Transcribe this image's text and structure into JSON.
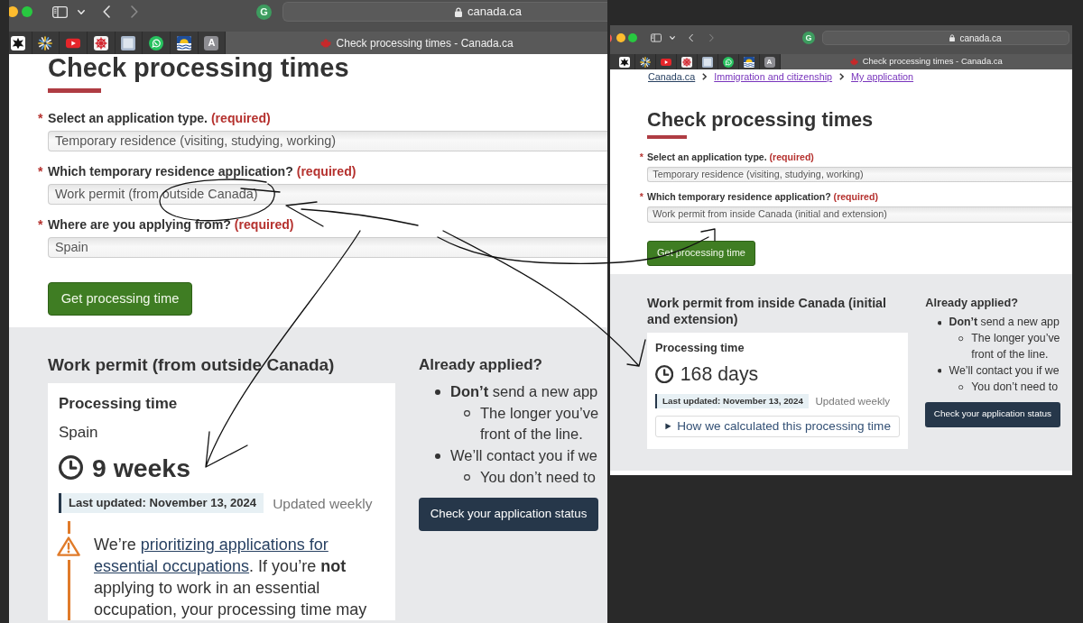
{
  "windows": [
    {
      "toolbar": {
        "extension_badge": "G",
        "address": "canada.ca"
      },
      "bookmarks": [
        {
          "kind": "splat"
        },
        {
          "kind": "sunburst"
        },
        {
          "kind": "video"
        },
        {
          "kind": "snowflake"
        },
        {
          "kind": "square"
        },
        {
          "kind": "chat"
        },
        {
          "kind": "flag"
        },
        {
          "kind": "letter",
          "label": "A"
        }
      ],
      "tab": {
        "title": "Check processing times - Canada.ca"
      },
      "page": {
        "heading": "Check processing times",
        "fields": [
          {
            "mark": "*",
            "label": "Select an application type.",
            "required": "(required)",
            "value": "Temporary residence (visiting, studying, working)"
          },
          {
            "mark": "*",
            "label": "Which temporary residence application?",
            "required": "(required)",
            "value": "Work permit (from outside Canada)"
          },
          {
            "mark": "*",
            "label": "Where are you applying from?",
            "required": "(required)",
            "value": "Spain"
          }
        ],
        "submit": "Get processing time",
        "result": {
          "heading": "Work permit (from outside Canada)",
          "card_title": "Processing time",
          "location": "Spain",
          "duration": "9 weeks",
          "last_updated": "Last updated: November 13, 2024",
          "frequency": "Updated weekly",
          "notice": {
            "before": "We’re ",
            "link": [
              "prioritizing applications for",
              "essential occupations"
            ],
            "after": ". If you’re **not** applying to work in an essential occupation, your processing time may"
          }
        },
        "aside": {
          "heading": "Already applied?",
          "items": [
            {
              "lines": [
                "**Don’t** send a new app"
              ],
              "children": [
                {
                  "lines": [
                    "The longer you’ve",
                    "front of the line."
                  ]
                }
              ]
            },
            {
              "lines": [
                "We’ll contact you if we"
              ],
              "children": [
                {
                  "lines": [
                    "You don’t need to"
                  ]
                }
              ]
            }
          ],
          "button": "Check your application status"
        }
      }
    },
    {
      "toolbar": {
        "extension_badge": "G",
        "address": "canada.ca"
      },
      "bookmarks": [
        {
          "kind": "splat"
        },
        {
          "kind": "sunburst"
        },
        {
          "kind": "video"
        },
        {
          "kind": "snowflake"
        },
        {
          "kind": "square"
        },
        {
          "kind": "chat"
        },
        {
          "kind": "flag"
        },
        {
          "kind": "letter",
          "label": "A"
        }
      ],
      "tab": {
        "title": "Check processing times - Canada.ca"
      },
      "page": {
        "breadcrumb": [
          {
            "text": "Canada.ca",
            "visited": false
          },
          {
            "text": "Immigration and citizenship",
            "visited": true
          },
          {
            "text": "My application",
            "visited": true
          }
        ],
        "heading": "Check processing times",
        "fields": [
          {
            "mark": "*",
            "label": "Select an application type.",
            "required": "(required)",
            "value": "Temporary residence (visiting, studying, working)"
          },
          {
            "mark": "*",
            "label": "Which temporary residence application?",
            "required": "(required)",
            "value": "Work permit from inside Canada (initial and extension)"
          }
        ],
        "submit": "Get processing time",
        "result": {
          "heading": "Work permit from inside Canada (initial and extension)",
          "card_title": "Processing time",
          "duration": "168 days",
          "last_updated": "Last updated: November 13, 2024",
          "frequency": "Updated weekly",
          "details": {
            "label": "How we calculated this processing time",
            "expanded": false
          }
        },
        "aside": {
          "heading": "Already applied?",
          "items": [
            {
              "lines": [
                "**Don’t** send a new app"
              ],
              "children": [
                {
                  "lines": [
                    "The longer you’ve",
                    "front of the line."
                  ]
                }
              ]
            },
            {
              "lines": [
                "We’ll contact you if we"
              ],
              "children": [
                {
                  "lines": [
                    "You don’t need to"
                  ]
                }
              ]
            }
          ],
          "button": "Check your application status"
        }
      }
    }
  ]
}
